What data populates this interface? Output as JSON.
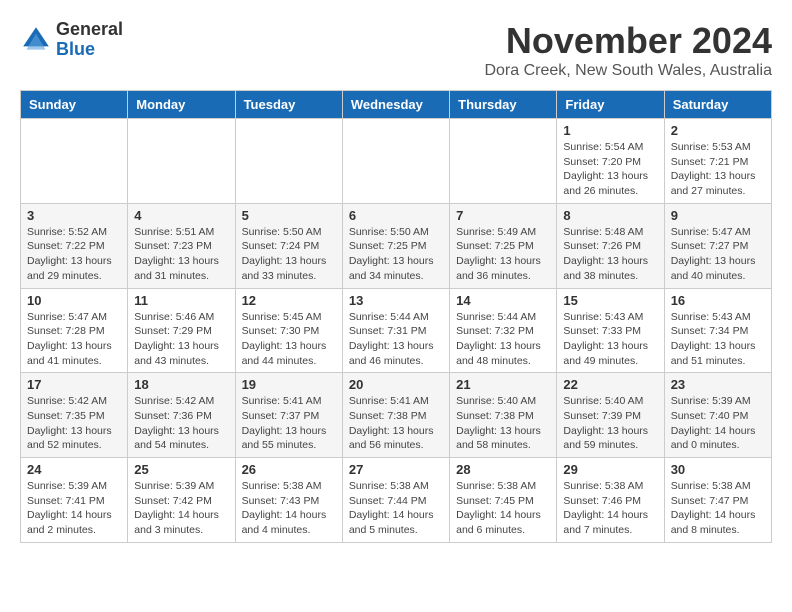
{
  "header": {
    "logo_general": "General",
    "logo_blue": "Blue",
    "month_title": "November 2024",
    "location": "Dora Creek, New South Wales, Australia"
  },
  "days_of_week": [
    "Sunday",
    "Monday",
    "Tuesday",
    "Wednesday",
    "Thursday",
    "Friday",
    "Saturday"
  ],
  "weeks": [
    [
      {
        "day": "",
        "info": ""
      },
      {
        "day": "",
        "info": ""
      },
      {
        "day": "",
        "info": ""
      },
      {
        "day": "",
        "info": ""
      },
      {
        "day": "",
        "info": ""
      },
      {
        "day": "1",
        "info": "Sunrise: 5:54 AM\nSunset: 7:20 PM\nDaylight: 13 hours and 26 minutes."
      },
      {
        "day": "2",
        "info": "Sunrise: 5:53 AM\nSunset: 7:21 PM\nDaylight: 13 hours and 27 minutes."
      }
    ],
    [
      {
        "day": "3",
        "info": "Sunrise: 5:52 AM\nSunset: 7:22 PM\nDaylight: 13 hours and 29 minutes."
      },
      {
        "day": "4",
        "info": "Sunrise: 5:51 AM\nSunset: 7:23 PM\nDaylight: 13 hours and 31 minutes."
      },
      {
        "day": "5",
        "info": "Sunrise: 5:50 AM\nSunset: 7:24 PM\nDaylight: 13 hours and 33 minutes."
      },
      {
        "day": "6",
        "info": "Sunrise: 5:50 AM\nSunset: 7:25 PM\nDaylight: 13 hours and 34 minutes."
      },
      {
        "day": "7",
        "info": "Sunrise: 5:49 AM\nSunset: 7:25 PM\nDaylight: 13 hours and 36 minutes."
      },
      {
        "day": "8",
        "info": "Sunrise: 5:48 AM\nSunset: 7:26 PM\nDaylight: 13 hours and 38 minutes."
      },
      {
        "day": "9",
        "info": "Sunrise: 5:47 AM\nSunset: 7:27 PM\nDaylight: 13 hours and 40 minutes."
      }
    ],
    [
      {
        "day": "10",
        "info": "Sunrise: 5:47 AM\nSunset: 7:28 PM\nDaylight: 13 hours and 41 minutes."
      },
      {
        "day": "11",
        "info": "Sunrise: 5:46 AM\nSunset: 7:29 PM\nDaylight: 13 hours and 43 minutes."
      },
      {
        "day": "12",
        "info": "Sunrise: 5:45 AM\nSunset: 7:30 PM\nDaylight: 13 hours and 44 minutes."
      },
      {
        "day": "13",
        "info": "Sunrise: 5:44 AM\nSunset: 7:31 PM\nDaylight: 13 hours and 46 minutes."
      },
      {
        "day": "14",
        "info": "Sunrise: 5:44 AM\nSunset: 7:32 PM\nDaylight: 13 hours and 48 minutes."
      },
      {
        "day": "15",
        "info": "Sunrise: 5:43 AM\nSunset: 7:33 PM\nDaylight: 13 hours and 49 minutes."
      },
      {
        "day": "16",
        "info": "Sunrise: 5:43 AM\nSunset: 7:34 PM\nDaylight: 13 hours and 51 minutes."
      }
    ],
    [
      {
        "day": "17",
        "info": "Sunrise: 5:42 AM\nSunset: 7:35 PM\nDaylight: 13 hours and 52 minutes."
      },
      {
        "day": "18",
        "info": "Sunrise: 5:42 AM\nSunset: 7:36 PM\nDaylight: 13 hours and 54 minutes."
      },
      {
        "day": "19",
        "info": "Sunrise: 5:41 AM\nSunset: 7:37 PM\nDaylight: 13 hours and 55 minutes."
      },
      {
        "day": "20",
        "info": "Sunrise: 5:41 AM\nSunset: 7:38 PM\nDaylight: 13 hours and 56 minutes."
      },
      {
        "day": "21",
        "info": "Sunrise: 5:40 AM\nSunset: 7:38 PM\nDaylight: 13 hours and 58 minutes."
      },
      {
        "day": "22",
        "info": "Sunrise: 5:40 AM\nSunset: 7:39 PM\nDaylight: 13 hours and 59 minutes."
      },
      {
        "day": "23",
        "info": "Sunrise: 5:39 AM\nSunset: 7:40 PM\nDaylight: 14 hours and 0 minutes."
      }
    ],
    [
      {
        "day": "24",
        "info": "Sunrise: 5:39 AM\nSunset: 7:41 PM\nDaylight: 14 hours and 2 minutes."
      },
      {
        "day": "25",
        "info": "Sunrise: 5:39 AM\nSunset: 7:42 PM\nDaylight: 14 hours and 3 minutes."
      },
      {
        "day": "26",
        "info": "Sunrise: 5:38 AM\nSunset: 7:43 PM\nDaylight: 14 hours and 4 minutes."
      },
      {
        "day": "27",
        "info": "Sunrise: 5:38 AM\nSunset: 7:44 PM\nDaylight: 14 hours and 5 minutes."
      },
      {
        "day": "28",
        "info": "Sunrise: 5:38 AM\nSunset: 7:45 PM\nDaylight: 14 hours and 6 minutes."
      },
      {
        "day": "29",
        "info": "Sunrise: 5:38 AM\nSunset: 7:46 PM\nDaylight: 14 hours and 7 minutes."
      },
      {
        "day": "30",
        "info": "Sunrise: 5:38 AM\nSunset: 7:47 PM\nDaylight: 14 hours and 8 minutes."
      }
    ]
  ]
}
